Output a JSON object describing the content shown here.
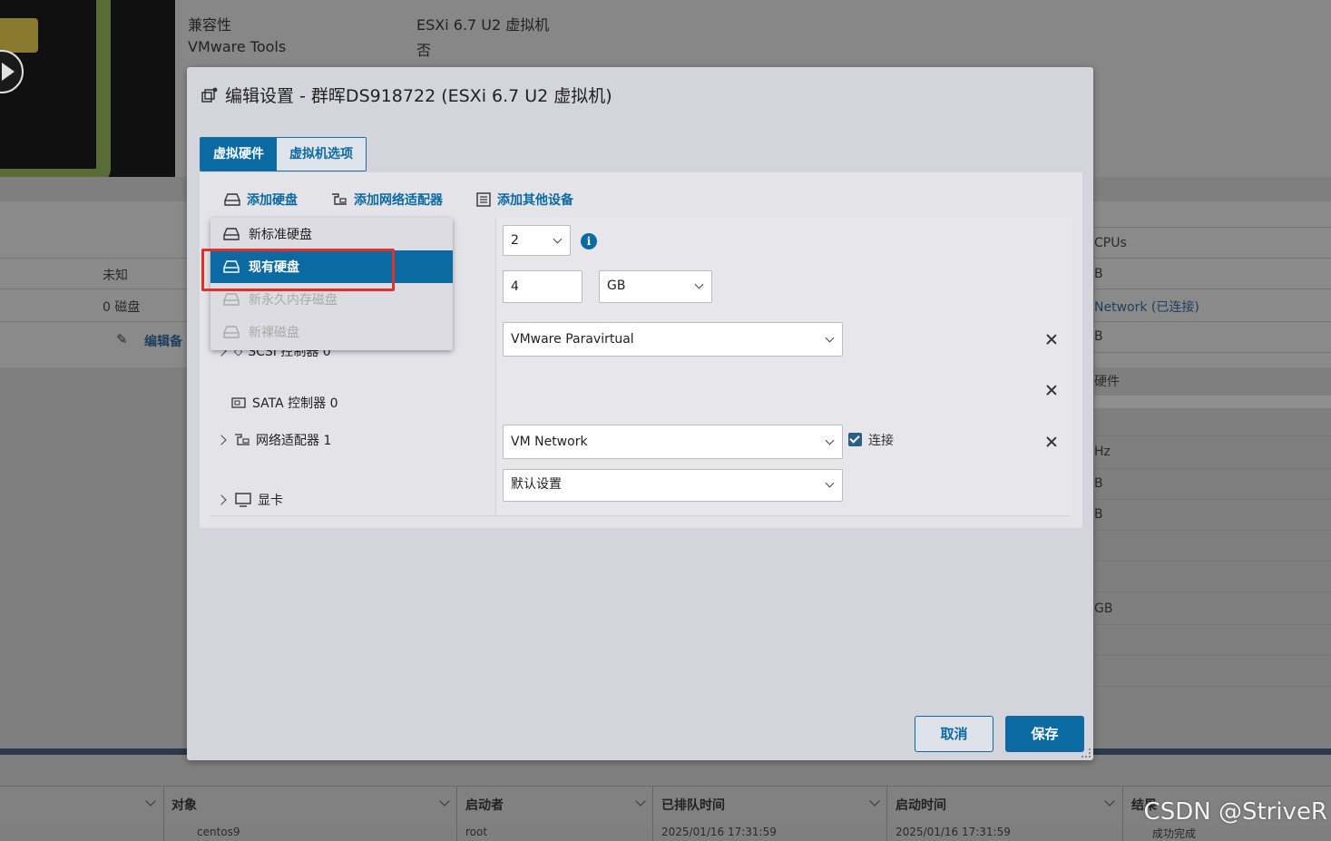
{
  "background": {
    "labels": [
      "兼容性",
      "VMware Tools"
    ],
    "values": [
      "ESXi 6.7 U2 虚拟机",
      "否"
    ],
    "left_texts": [
      "未知",
      "0 磁盘"
    ],
    "edit_link": "编辑备",
    "right_texts": [
      "CPUs",
      "B",
      "Network (已连接)",
      "B",
      "硬件",
      "Hz",
      "B",
      "B",
      "GB"
    ],
    "table_headers": [
      "对象",
      "启动者",
      "已排队时间",
      "启动时间",
      "结果"
    ],
    "table_row": [
      "centos9",
      "root",
      "2025/01/16 17:31:59",
      "2025/01/16 17:31:59",
      "成功完成"
    ],
    "watermark": "CSDN @StriveR"
  },
  "dialog": {
    "title": "编辑设置 - 群晖DS918722 (ESXi 6.7 U2 虚拟机)",
    "tabs": [
      {
        "label": "虚拟硬件",
        "active": true
      },
      {
        "label": "虚拟机选项",
        "active": false
      }
    ],
    "toolbar": {
      "add_disk": "添加硬盘",
      "add_network": "添加网络适配器",
      "add_other": "添加其他设备"
    },
    "add_disk_menu": [
      {
        "label": "新标准硬盘",
        "state": "normal"
      },
      {
        "label": "现有硬盘",
        "state": "selected"
      },
      {
        "label": "新永久内存磁盘",
        "state": "disabled"
      },
      {
        "label": "新裸磁盘",
        "state": "disabled"
      }
    ],
    "rows": {
      "cpu_value": "2",
      "memory_value": "4",
      "memory_unit": "GB",
      "scsi_label": "SCSI 控制器 0",
      "scsi_value": "VMware Paravirtual",
      "sata_label": "SATA 控制器 0",
      "net_label": "网络适配器 1",
      "net_value": "VM Network",
      "net_connect": "连接",
      "display_label": "显卡",
      "display_value": "默认设置"
    },
    "buttons": {
      "cancel": "取消",
      "save": "保存"
    }
  }
}
